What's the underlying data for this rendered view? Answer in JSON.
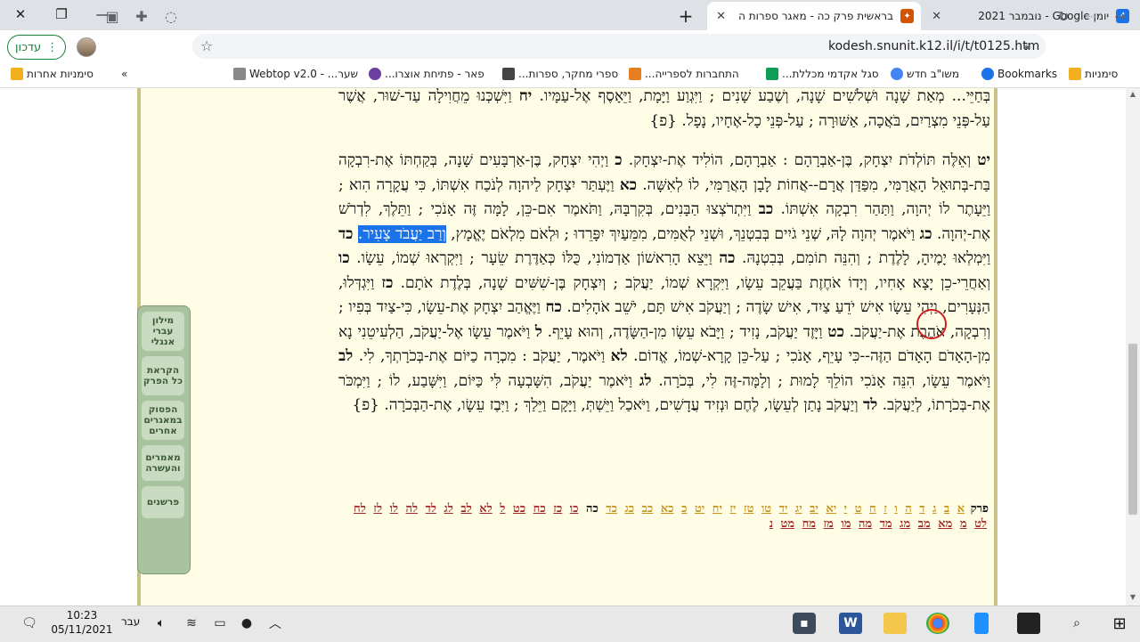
{
  "tabs": [
    {
      "title": "בראשית פרק כה - מאגר ספרות ה",
      "active": true,
      "favicon_color": "#d35400"
    },
    {
      "title": "יומן Google - נובמבר 2021",
      "active": false,
      "favicon_color": "#1a73e8"
    }
  ],
  "toolbar": {
    "update_label": "עדכון",
    "url": "kodesh.snunit.k12.il/i/t/t0125.htm"
  },
  "bookmarks": {
    "items": [
      {
        "label": "סימניות",
        "color": "#f2b01e"
      },
      {
        "label": "Bookmarks",
        "color": "#1a73e8"
      },
      {
        "label": "משו\"ב חדש",
        "color": "#4285f4"
      },
      {
        "label": "סגל אקדמי מכללת...",
        "color": "#0f9d58"
      },
      {
        "label": "התחברות לספרייה...",
        "color": "#e67e22"
      },
      {
        "label": "ספרי מחקר, ספרות...",
        "color": "#444444"
      },
      {
        "label": "פאר - פתיחת אוצרו...",
        "color": "#6a3fa0"
      },
      {
        "label": "שער... - Webtop v2.0",
        "color": "#888888"
      }
    ],
    "more": "»",
    "other": "סימניות אחרות"
  },
  "text": {
    "top_lines": "בְּחַיֵּי... מְאַת שָׁנָה וּשְׁלֹשִׁים שָׁנָה, וְשֶׁבַע שָׁנִים ; וַיִּגְוַע וַיָּמָת, וַיֵּאָסֶף אֶל-עַמָּיו.",
    "v18_num": "יח",
    "v18": "וַיִּשְׁכְּנוּ מֵחֲוִילָה עַד-שׁוּר, אֲשֶׁר עַל-פְּנֵי מִצְרַיִם, בֹּאֲכָה, אַשּׁוּרָה ; עַל-פְּנֵי כָל-אֶחָיו, נָפָל.",
    "petucha": "{פ}",
    "v19_num": "יט",
    "v19": "וְאֵלֶּה תּוֹלְדֹת יִצְחָק, בֶּן-אַבְרָהָם : אַבְרָהָם, הוֹלִיד אֶת-יִצְחָק.",
    "v20_num": "כ",
    "v20": "וַיְהִי יִצְחָק, בֶּן-אַרְבָּעִים שָׁנָה, בְּקַחְתּוֹ אֶת-רִבְקָה בַּת-בְּתוּאֵל הָאֲרַמִּי, מִפַּדַּן אֲרָם--אֲחוֹת לָבָן הָאֲרַמִּי, לוֹ לְאִשָּׁה.",
    "v21_num": "כא",
    "v21": "וַיֶּעְתַּר יִצְחָק לַיהוָה לְנֹכַח אִשְׁתּוֹ, כִּי עֲקָרָה הִוא ; וַיֵּעָתֶר לוֹ יְהוָה, וַתַּהַר רִבְקָה אִשְׁתּוֹ.",
    "v22_num": "כב",
    "v22": "וַיִּתְרֹצְצוּ הַבָּנִים, בְּקִרְבָּהּ, וַתֹּאמֶר אִם-כֵּן, לָמָּה זֶּה אָנֹכִי ; וַתֵּלֶךְ, לִדְרֹשׁ אֶת-יְהוָה.",
    "v23_num": "כג",
    "v23_a": "וַיֹּאמֶר יְהוָה לָהּ, שְׁנֵי גֹיִים בְּבִטְנֵךְ, וּשְׁנֵי לְאֻמִּים, מִמֵּעַיִךְ יִפָּרֵדוּ ; וּלְאֹם מִלְאֹם יֶאֱמָץ, ",
    "v23_highlight": "וְרַב יַעֲבֹד צָעִיר.",
    "v24_num": "כד",
    "v24": "וַיִּמְלְאוּ יָמֶיהָ, לָלֶדֶת ; וְהִנֵּה תוֹמִם, בְּבִטְנָהּ.",
    "v25_num": "כה",
    "v25": "וַיֵּצֵא הָרִאשׁוֹן אַדְמוֹנִי, כֻּלּוֹ כְּאַדֶּרֶת שֵׂעָר ; וַיִּקְרְאוּ שְׁמוֹ, עֵשָׂו.",
    "v26_num": "כו",
    "v26": "וְאַחֲרֵי-כֵן יָצָא אָחִיו, וְיָדוֹ אֹחֶזֶת בַּעֲקֵב עֵשָׂו, וַיִּקְרָא שְׁמוֹ, יַעֲקֹב ; וְיִצְחָק בֶּן-שִׁשִּׁים שָׁנָה, בְּלֶדֶת אֹתָם.",
    "v27_num": "כז",
    "v27": "וַיִּגְדְּלוּ, הַנְּעָרִים, וַיְהִי עֵשָׂו אִישׁ יֹדֵעַ צַיִד, אִישׁ שָׂדֶה ; וְיַעֲקֹב אִישׁ תָּם, יֹשֵׁב אֹהָלִים.",
    "v28_num": "כח",
    "v28": "וַיֶּאֱהַב יִצְחָק אֶת-עֵשָׂו, כִּי-צַיִד בְּפִיו ; וְרִבְקָה, אֹהֶבֶת אֶת-יַעֲקֹב.",
    "v29_num": "כט",
    "v29": "וַיָּזֶד יַעֲקֹב, נָזִיד ; וַיָּבֹא עֵשָׂו מִן-הַשָּׂדֶה, וְהוּא עָיֵף.",
    "v30_num": "ל",
    "v30": "וַיֹּאמֶר עֵשָׂו אֶל-יַעֲקֹב, הַלְעִיטֵנִי נָא מִן-הָאָדֹם הָאָדֹם הַזֶּה--כִּי עָיֵף, אָנֹכִי ; עַל-כֵּן קָרָא-שְׁמוֹ, אֱדוֹם.",
    "v31_num": "לא",
    "v31": "וַיֹּאמֶר, יַעֲקֹב : מִכְרָה כַיּוֹם אֶת-בְּכֹרָתְךָ, לִי.",
    "v32_num": "לב",
    "v32": "וַיֹּאמֶר עֵשָׂו, הִנֵּה אָנֹכִי הוֹלֵךְ לָמוּת ; וְלָמָּה-זֶּה לִי, בְּכֹרָה.",
    "v33_num": "לג",
    "v33": "וַיֹּאמֶר יַעֲקֹב, הִשָּׁבְעָה לִּי כַּיּוֹם, וַיִּשָּׁבַע, לוֹ ; וַיִּמְכֹּר אֶת-בְּכֹרָתוֹ, לְיַעֲקֹב.",
    "v34_num": "לד",
    "v34": "וְיַעֲקֹב נָתַן לְעֵשָׂו, לֶחֶם וּנְזִיד עֲדָשִׁים, וַיֹּאכַל וַיֵּשְׁתְּ, וַיָּקָם וַיֵּלַךְ ; וַיִּבֶז עֵשָׂו, אֶת-הַבְּכֹרָה."
  },
  "sidepanel": {
    "items": [
      "מילון עברי אנגלי",
      "הקראת כל הפרק",
      "הפסוק במאגרים אחרים",
      "מאמרים והעשרה",
      "פרשנים"
    ]
  },
  "chapters": {
    "label": "פרק",
    "current": "כה",
    "items": [
      "א",
      "ב",
      "ג",
      "ד",
      "ה",
      "ו",
      "ז",
      "ח",
      "ט",
      "י",
      "יא",
      "יב",
      "יג",
      "יד",
      "טו",
      "טז",
      "יז",
      "יח",
      "יט",
      "כ",
      "כא",
      "כב",
      "כג",
      "כד",
      "כה",
      "כו",
      "כז",
      "כח",
      "כט",
      "ל",
      "לא",
      "לב",
      "לג",
      "לד",
      "לה",
      "לו",
      "לז",
      "לח",
      "לט",
      "מ",
      "מא",
      "מב",
      "מג",
      "מד",
      "מה",
      "מו",
      "מז",
      "מח",
      "מט",
      "נ"
    ],
    "color_done": "#c8931a",
    "color_rest": "#a52a2a"
  },
  "taskbar": {
    "time": "10:23",
    "date": "05/11/2021",
    "lang": "עבר"
  }
}
